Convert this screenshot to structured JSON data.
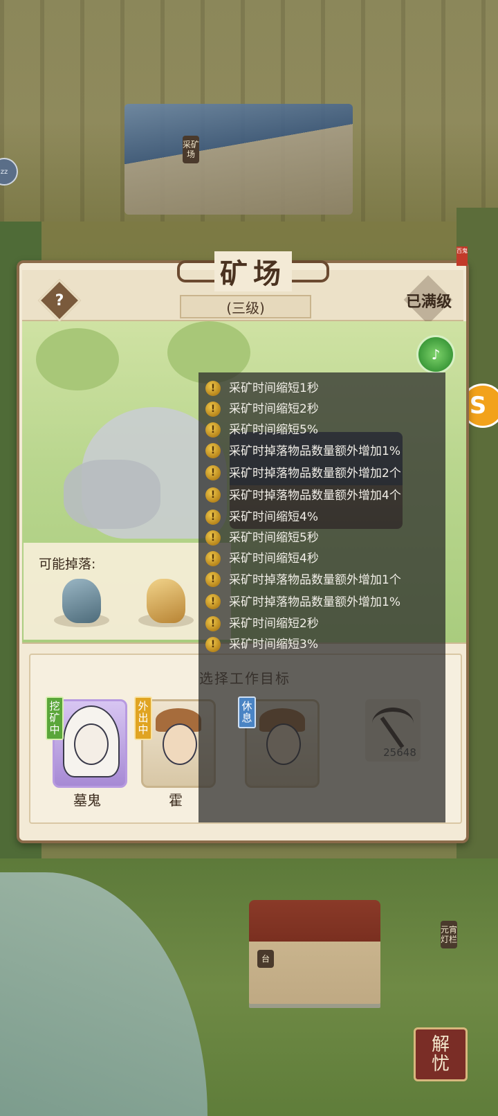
{
  "map": {
    "sign_mine": "采矿场",
    "sign_lantern": "元宵灯栏",
    "sign_tai": "台",
    "left_badge": "zz",
    "right_button": "S",
    "bottom_right_button": [
      "解",
      "忧"
    ]
  },
  "panel": {
    "title": "矿场",
    "seal": "百鬼",
    "help_icon": "question-icon",
    "help_label": "?",
    "level": "(三级)",
    "max_level": "已满级",
    "sound_icon": "sound-icon",
    "drops_label": "可能掉落:",
    "drops": [
      {
        "name": "blue-ore",
        "color": "#4d6b7a"
      },
      {
        "name": "gold-ore",
        "color": "#b88434"
      }
    ],
    "work_target_title": "选择工作目标",
    "workers": [
      {
        "name": "墓鬼",
        "status": "挖矿中",
        "status_color": "#5aa63a"
      },
      {
        "name": "霍",
        "status": "外出中",
        "status_color": "#e0a422"
      },
      {
        "name": "",
        "status": "休息",
        "status_color": "#4a84c4"
      }
    ],
    "pickaxe_count": "25648"
  },
  "tooltip": {
    "items": [
      "采矿时间缩短1秒",
      "采矿时间缩短2秒",
      "采矿时间缩短5%",
      "采矿时掉落物品数量额外增加1%",
      "采矿时掉落物品数量额外增加2个",
      "采矿时掉落物品数量额外增加4个",
      "采矿时间缩短4%",
      "采矿时间缩短5秒",
      "采矿时间缩短4秒",
      "采矿时掉落物品数量额外增加1个",
      "采矿时掉落物品数量额外增加1%",
      "采矿时间缩短2秒",
      "采矿时间缩短3%"
    ]
  }
}
